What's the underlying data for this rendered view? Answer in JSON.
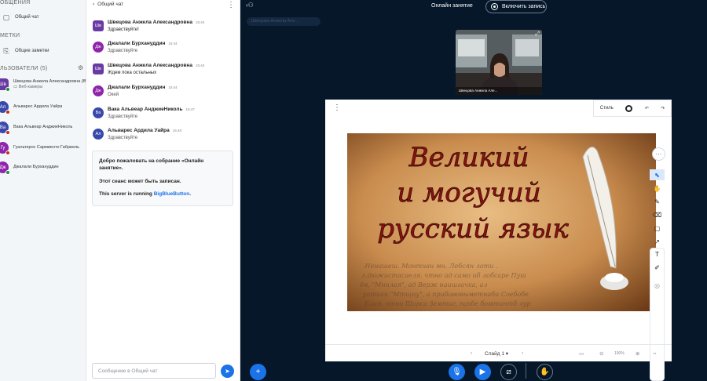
{
  "sidebar": {
    "section_messages": "ОБЩЕНИЯ",
    "public_chat": "Общий чат",
    "section_notes": "МЕТКИ",
    "shared_notes": "Общие заметки",
    "section_users": "ЛЬЗОВАТЕЛИ (5)",
    "users": [
      {
        "initials": "Шв",
        "name": "Швецова Анжела Александровна",
        "you": "(Вы)",
        "sub": "Веб-камера",
        "color": "#6a3aa3",
        "shape": "square",
        "status": "#1a8f3c"
      },
      {
        "initials": "Ал",
        "name": "Альварес Ардила Уайра",
        "color": "#3949ab",
        "shape": "round",
        "status": "#c62828"
      },
      {
        "initials": "Ва",
        "name": "Вака Альвеар АнджиеНиколь",
        "color": "#3949ab",
        "shape": "round",
        "status": "#c62828"
      },
      {
        "initials": "Гу",
        "name": "Гуальтерос Сармиенто Габриель",
        "color": "#8e24aa",
        "shape": "round",
        "status": "#c62828"
      },
      {
        "initials": "Дж",
        "name": "Джалали Бурхануддин",
        "color": "#8e24aa",
        "shape": "round",
        "status": "#1a8f3c"
      }
    ]
  },
  "chat": {
    "title": "Общий чат",
    "messages": [
      {
        "initials": "Шв",
        "name": "Швецова Анжела Александровна",
        "time": "15:44",
        "text": "Здравствуйте!",
        "color": "#6a3aa3",
        "shape": "square",
        "strong": true
      },
      {
        "initials": "Дж",
        "name": "Джалали Бурхануддин",
        "time": "15:44",
        "text": "Здравствуйте",
        "color": "#8e24aa",
        "shape": "round",
        "strong": false
      },
      {
        "initials": "Шв",
        "name": "Швецова Анжела Александровна",
        "time": "15:44",
        "text": "Ждем пока остальных",
        "color": "#6a3aa3",
        "shape": "square",
        "strong": true
      },
      {
        "initials": "Дж",
        "name": "Джалали Бурхануддин",
        "time": "15:44",
        "text": "Окей",
        "color": "#8e24aa",
        "shape": "round",
        "strong": false
      },
      {
        "initials": "Ва",
        "name": "Вака Альвеар АнджиеНиколь",
        "time": "15:47",
        "text": "Здравствуйте",
        "color": "#3949ab",
        "shape": "round",
        "strong": false
      },
      {
        "initials": "Ал",
        "name": "Альварес Ардила Уайра",
        "time": "15:48",
        "text": "Здравствуйте",
        "color": "#3949ab",
        "shape": "round",
        "strong": false
      }
    ],
    "welcome_title": "Добро пожаловать на собрание «Онлайн занятие».",
    "welcome_recorded": "Этот сеанс может быть записан.",
    "welcome_server": "This server is running ",
    "welcome_link": "BigBlueButton",
    "welcome_end": ".",
    "input_placeholder": "Сообщение в Общий чат"
  },
  "main": {
    "title": "Онлайн занятие",
    "record_label": "Включить запись",
    "presenter_pill": "Швецова Анжела Але...",
    "webcam_name": "Швецова Анжела Але...",
    "style_label": "Стиль",
    "slide_text_line1": "Великий",
    "slide_text_line2": "и могучий",
    "slide_text_line3": "русский язык",
    "slide_selector": "Слайд 1",
    "zoom": "100%"
  },
  "colors": {
    "accent": "#1b73e8",
    "background": "#06172a",
    "slide_title": "#8b1010"
  }
}
